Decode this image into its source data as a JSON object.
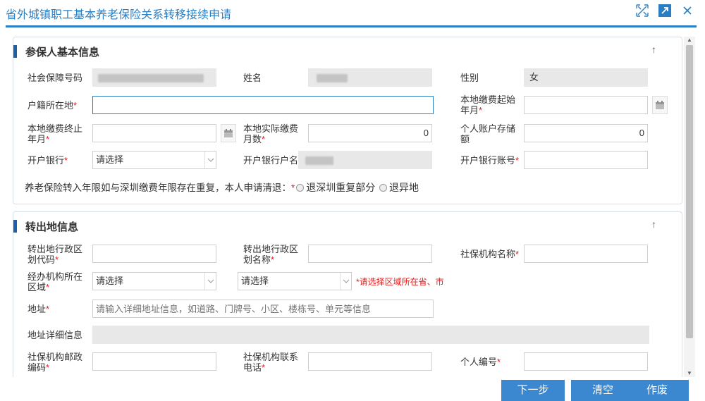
{
  "dialog": {
    "title": "省外城镇职工基本养老保险关系转移接续申请"
  },
  "header_icons": [
    "fullscreen-icon",
    "open-external-icon",
    "close-icon"
  ],
  "section1": {
    "title": "参保人基本信息",
    "toggle": "↑",
    "fields": {
      "ss_number_label": "社会保障号码",
      "name_label": "姓名",
      "gender_label": "性别",
      "gender_value": "女",
      "hukou_label": "户籍所在地",
      "start_month_label_1": "本地缴费起始",
      "start_month_label_2": "年月",
      "end_month_label_1": "本地缴费终止",
      "end_month_label_2": "年月",
      "actual_months_label_1": "本地实际缴费",
      "actual_months_label_2": "月数",
      "actual_months_value": "0",
      "account_balance_label_1": "个人账户存储",
      "account_balance_label_2": "额",
      "account_balance_value": "0",
      "bank_label": "开户银行",
      "bank_select": "请选择",
      "bank_account_name_label": "开户银行户名",
      "bank_account_no_label": "开户银行账号"
    },
    "overlap_question": "养老保险转入年限如与深圳缴费年限存在重复，本人申请清退：",
    "overlap_options": [
      "退深圳重复部分",
      "退异地"
    ]
  },
  "section2": {
    "title": "转出地信息",
    "toggle": "↑",
    "fields": {
      "region_code_label_1": "转出地行政区",
      "region_code_label_2": "划代码",
      "region_name_label_1": "转出地行政区",
      "region_name_label_2": "划名称",
      "agency_name_label": "社保机构名称",
      "agency_region_label_1": "经办机构所在",
      "agency_region_label_2": "区域",
      "province_select": "请选择",
      "city_select": "请选择",
      "region_hint": "*请选择区域所在省、市",
      "address_label": "地址",
      "address_placeholder": "请输入详细地址信息，如道路、门牌号、小区、楼栋号、单元等信息",
      "address_detail_label": "地址详细信息",
      "postcode_label_1": "社保机构邮政",
      "postcode_label_2": "编码",
      "agency_phone_label_1": "社保机构联系",
      "agency_phone_label_2": "电话",
      "personal_no_label": "个人编号"
    }
  },
  "buttons": {
    "next": "下一步",
    "clear": "清空",
    "cancel": "作废"
  },
  "colors": {
    "accent": "#2a7fc4",
    "button": "#3b87d0",
    "required": "#e02020",
    "section_bar": "#1f5fa8"
  }
}
